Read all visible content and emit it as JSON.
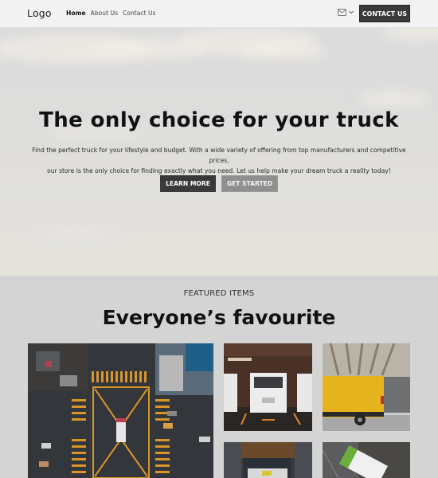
{
  "header": {
    "logo": "Logo",
    "nav": [
      {
        "label": "Home",
        "active": true
      },
      {
        "label": "About Us",
        "active": false
      },
      {
        "label": "Contact Us",
        "active": false
      }
    ],
    "language_icon": "mail-flag-icon",
    "contact_button": "CONTACT US"
  },
  "hero": {
    "title": "The only choice for your truck",
    "subtitle_line1": "Find the perfect truck for your lifestyle and budget. With a wide variety of offering from top manufacturers and competitive prices,",
    "subtitle_line2": "our store is the only choice for finding exactly what you need. Let us help make your dream truck a reality today!",
    "primary_button": "LEARN MORE",
    "secondary_button": "GET STARTED"
  },
  "featured": {
    "label": "FEATURED ITEMS",
    "title": "Everyone’s favourite",
    "images": [
      {
        "alt": "Aerial view of truck at crosswalk intersection"
      },
      {
        "alt": "White delivery trucks parked in garage"
      },
      {
        "alt": "Yellow van parked under trees"
      },
      {
        "alt": "Truck viewed through covered passage"
      },
      {
        "alt": "Green and white truck on road from above"
      }
    ]
  },
  "colors": {
    "header_bg": "#f2f2f2",
    "dark_button": "#3a3a3a",
    "gray_button": "#8f8f8f",
    "section_bg": "#d4d4d4"
  }
}
